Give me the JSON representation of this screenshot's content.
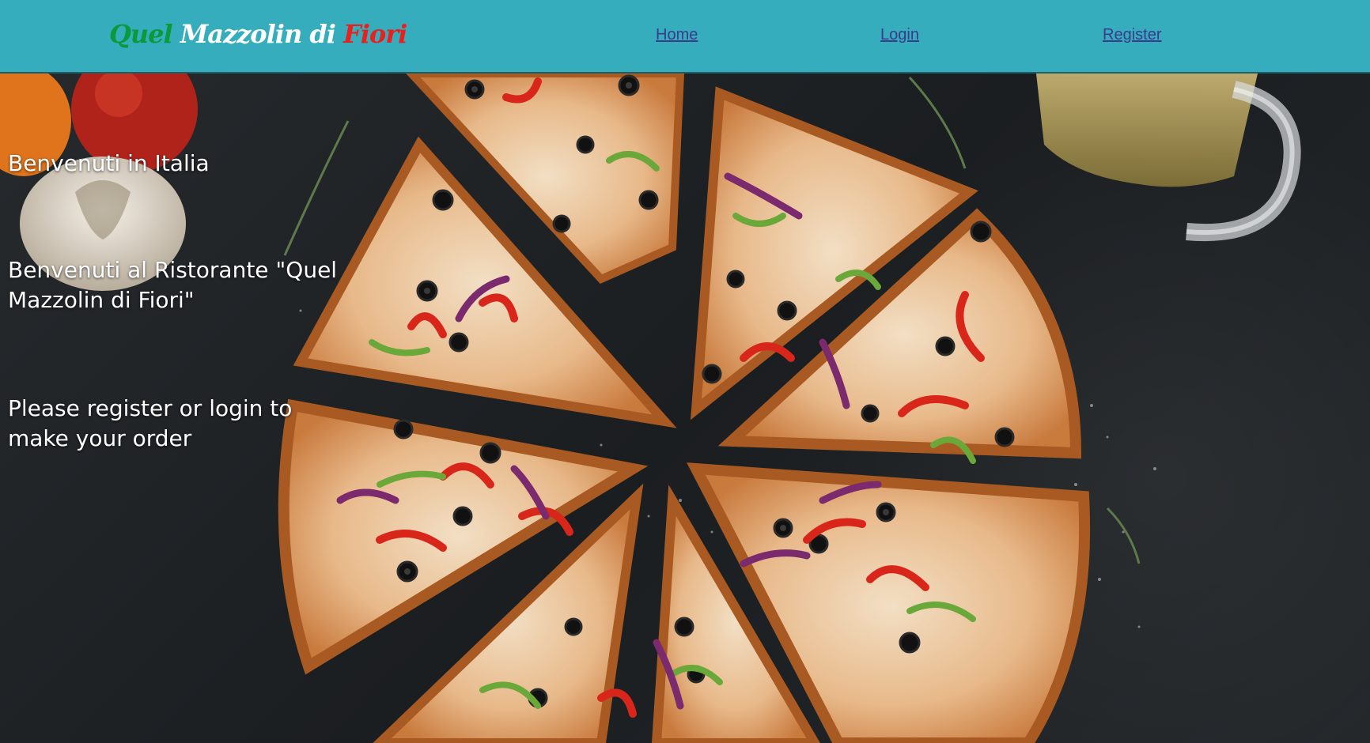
{
  "header": {
    "logo": {
      "word1": "Quel",
      "word2": "Mazzolin",
      "word3": "di",
      "word4": "Fiori"
    },
    "nav": {
      "home": "Home",
      "login": "Login",
      "register": "Register"
    }
  },
  "hero": {
    "greeting": "Benvenuti in Italia",
    "welcome": "Benvenuti al Ristorante \"Quel Mazzolin di Fiori\"",
    "prompt": "Please register or login to make your order"
  },
  "colors": {
    "header_bg": "#35adbd",
    "logo_green": "#0a9a3c",
    "logo_red": "#e8201e",
    "link": "#3b3a8c"
  }
}
